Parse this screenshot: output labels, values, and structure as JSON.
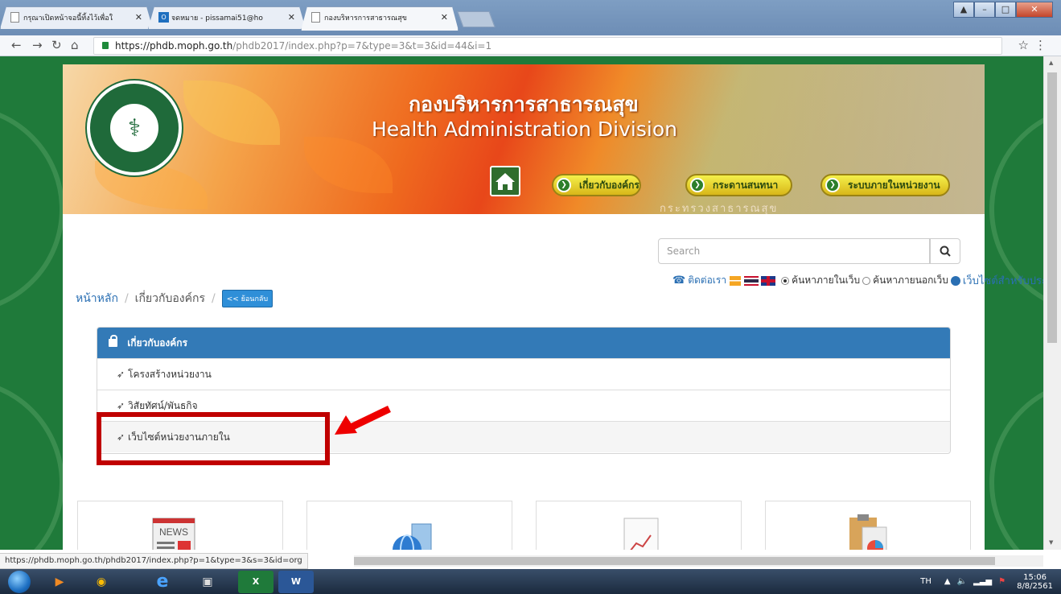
{
  "browser": {
    "tabs": [
      {
        "label": "กรุณาเปิดหน้าจอนี้ทิ้งไว้เพื่อใ"
      },
      {
        "label": "จดหมาย - pissamai51@ho"
      },
      {
        "label": "กองบริหารการสาธารณสุข"
      }
    ],
    "url_host": "https://phdb.moph.go.th",
    "url_path": "/phdb2017/index.php?p=7&type=3&t=3&id=44&i=1",
    "status_url": "https://phdb.moph.go.th/phdb2017/index.php?p=1&type=3&s=3&id=org"
  },
  "banner": {
    "title_th": "กองบริหารการสาธารณสุข",
    "title_en": "Health Administration Division",
    "watermark": "กระทรวงสาธารณสุข",
    "nav": [
      {
        "label": "เกี่ยวกับองค์กร"
      },
      {
        "label": "กระดานสนทนา"
      },
      {
        "label": "ระบบภายในหน่วยงาน"
      }
    ]
  },
  "search": {
    "placeholder": "Search",
    "contact_label": "ติดต่อเรา",
    "option_inside": "ค้นหาภายในเว็บ",
    "option_outside": "ค้นหาภายนอกเว็บ",
    "public_site": "เว็บไซต์สำหรับประชาชน"
  },
  "breadcrumb": {
    "home": "หน้าหลัก",
    "current": "เกี่ยวกับองค์กร",
    "back": "<< ย้อนกลับ"
  },
  "panel": {
    "heading": "เกี่ยวกับองค์กร",
    "items": [
      {
        "label": "โครงสร้างหน่วยงาน"
      },
      {
        "label": "วิสัยทัศน์/พันธกิจ"
      },
      {
        "label": "เว็บไซต์หน่วยงานภายใน"
      }
    ]
  },
  "cards": {
    "news_label": "NEWS"
  },
  "taskbar": {
    "language": "TH",
    "time": "15:06",
    "date": "8/8/2561"
  }
}
